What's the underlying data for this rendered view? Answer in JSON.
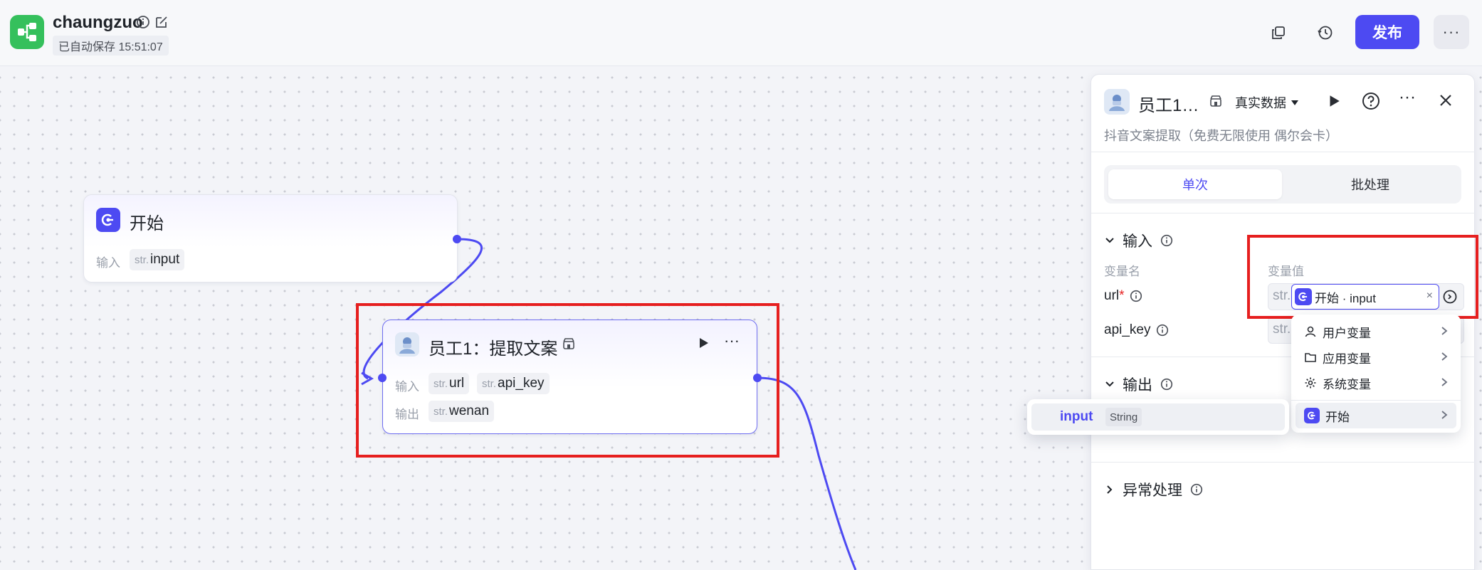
{
  "header": {
    "app_name": "chaungzuo",
    "autosave": "已自动保存 15:51:07",
    "publish_label": "发布"
  },
  "nodes": {
    "start": {
      "title": "开始",
      "input_label": "输入",
      "input_var": {
        "type": "str.",
        "name": "input"
      }
    },
    "employee": {
      "title": "员工1：提取文案",
      "input_label": "输入",
      "output_label": "输出",
      "inputs": [
        {
          "type": "str.",
          "name": "url"
        },
        {
          "type": "str.",
          "name": "api_key"
        }
      ],
      "output": {
        "type": "str.",
        "name": "wenan"
      }
    }
  },
  "panel": {
    "title": "员工1…",
    "data_mode": "真实数据",
    "description": "抖音文案提取（免费无限使用 偶尔会卡）",
    "tabs": {
      "single": "单次",
      "batch": "批处理"
    },
    "input_section": "输入",
    "col_name": "变量名",
    "col_value": "变量值",
    "fields": [
      {
        "name": "url",
        "required": "*"
      },
      {
        "name": "api_key"
      }
    ],
    "url_value": {
      "type": "str.",
      "source": "开始 · input"
    },
    "field2_type": "str.",
    "output_section": "输出",
    "error_section": "异常处理"
  },
  "dropdown": {
    "items": [
      {
        "label": "用户变量",
        "icon": "user-icon"
      },
      {
        "label": "应用变量",
        "icon": "folder-icon"
      },
      {
        "label": "系统变量",
        "icon": "gear-icon"
      },
      {
        "label": "开始",
        "icon": "start-node-icon"
      }
    ],
    "submenu": {
      "name": "input",
      "type": "String"
    }
  },
  "colors": {
    "accent": "#4d4af2",
    "highlight_red": "#e61f1f",
    "logo_green": "#35c05c"
  }
}
